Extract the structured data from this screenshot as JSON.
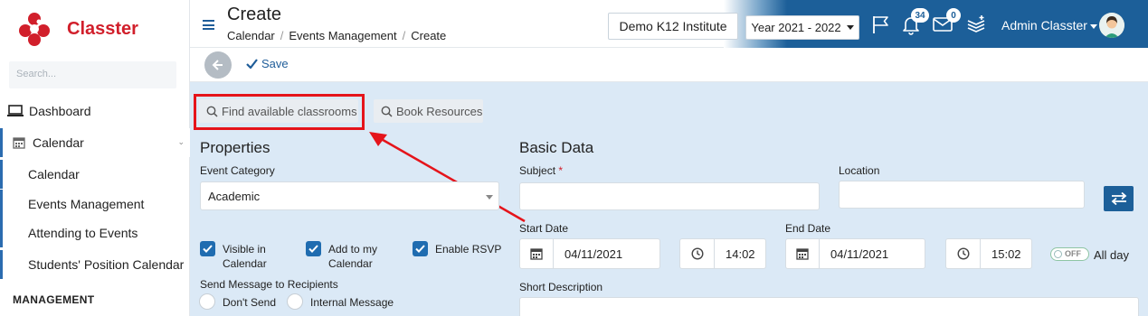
{
  "sidebar": {
    "brand": "Classter",
    "search_placeholder": "Search...",
    "items": [
      {
        "label": "Dashboard"
      },
      {
        "label": "Calendar"
      }
    ],
    "subitems": [
      {
        "label": "Calendar"
      },
      {
        "label": "Events Management"
      },
      {
        "label": "Attending to Events"
      },
      {
        "label": "Students' Position Calendar"
      }
    ],
    "section_heading": "MANAGEMENT"
  },
  "header": {
    "title": "Create",
    "breadcrumbs": [
      "Calendar",
      "Events Management",
      "Create"
    ],
    "institution": "Demo K12 Institute",
    "year": "Year 2021 - 2022",
    "notifications_count": "34",
    "messages_count": "0",
    "user_name": "Admin Classter"
  },
  "toolbar": {
    "save_label": "Save"
  },
  "actions": {
    "find_classrooms": "Find available classrooms",
    "book_resources": "Book Resources"
  },
  "properties": {
    "title": "Properties",
    "event_category_label": "Event Category",
    "event_category_value": "Academic",
    "visible_in_calendar": "Visible in Calendar",
    "add_to_my_calendar": "Add to my Calendar",
    "enable_rsvp": "Enable RSVP",
    "send_message_label": "Send Message to Recipients",
    "radio_dont_send": "Don't Send",
    "radio_internal": "Internal Message"
  },
  "basic_data": {
    "title": "Basic Data",
    "subject_label": "Subject",
    "location_label": "Location",
    "start_date_label": "Start Date",
    "start_date": "04/11/2021",
    "start_time": "14:02",
    "end_date_label": "End Date",
    "end_date": "04/11/2021",
    "end_time": "15:02",
    "toggle_text": "OFF",
    "all_day_label": "All day",
    "short_description_label": "Short Description"
  },
  "colors": {
    "accent": "#1c5f99",
    "brand_red": "#d11f2b",
    "highlight": "#e5141b",
    "content_bg": "#dbe9f6"
  }
}
